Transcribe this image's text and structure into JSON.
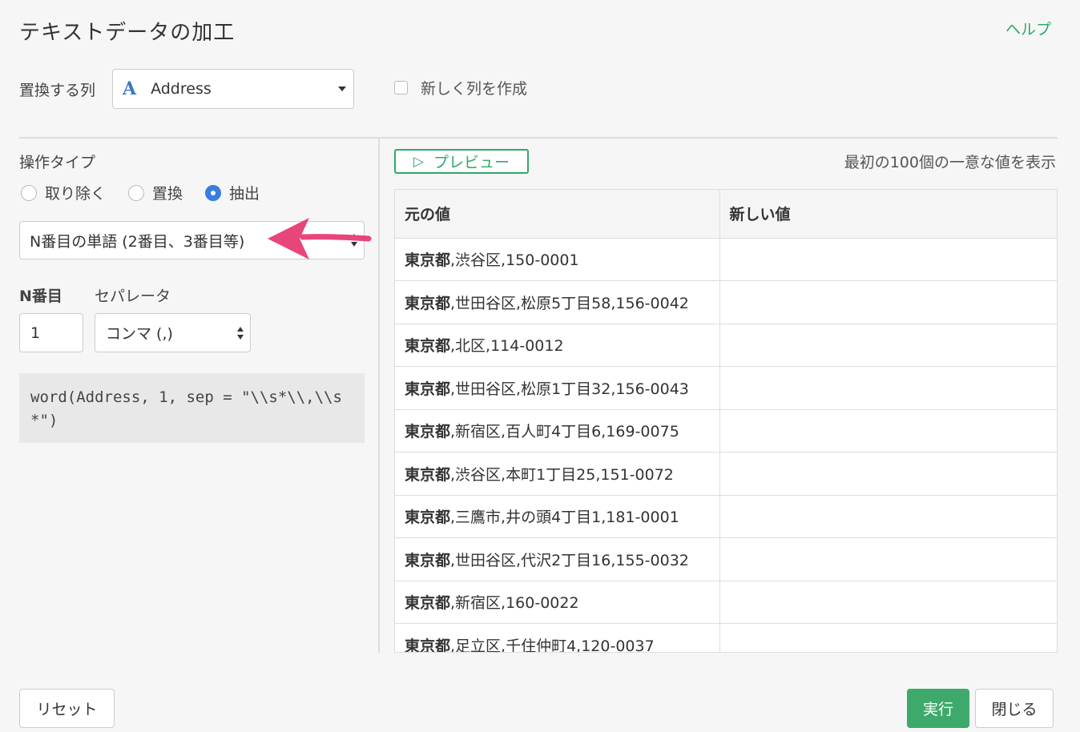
{
  "dialog": {
    "title": "テキストデータの加工",
    "help": "ヘルプ"
  },
  "column": {
    "label": "置換する列",
    "type_icon": "A",
    "selected": "Address",
    "new_column_label": "新しく列を作成",
    "new_column_checked": false
  },
  "operation": {
    "label": "操作タイプ",
    "options": [
      "取り除く",
      "置換",
      "抽出"
    ],
    "selected": "抽出",
    "method": "N番目の単語 (2番目、3番目等)"
  },
  "params": {
    "n_label": "N番目",
    "n_value": "1",
    "separator_label": "セパレータ",
    "separator_value": "コンマ (,)"
  },
  "code": "word(Address, 1, sep = \"\\\\s*\\\\,\\\\s*\")",
  "preview": {
    "button": "プレビュー",
    "note": "最初の100個の一意な値を表示",
    "headers": [
      "元の値",
      "新しい値"
    ],
    "rows": [
      {
        "pref": "東京都",
        "rest": ",渋谷区,150-0001",
        "new": ""
      },
      {
        "pref": "東京都",
        "rest": ",世田谷区,松原5丁目58,156-0042",
        "new": ""
      },
      {
        "pref": "東京都",
        "rest": ",北区,114-0012",
        "new": ""
      },
      {
        "pref": "東京都",
        "rest": ",世田谷区,松原1丁目32,156-0043",
        "new": ""
      },
      {
        "pref": "東京都",
        "rest": ",新宿区,百人町4丁目6,169-0075",
        "new": ""
      },
      {
        "pref": "東京都",
        "rest": ",渋谷区,本町1丁目25,151-0072",
        "new": ""
      },
      {
        "pref": "東京都",
        "rest": ",三鷹市,井の頭4丁目1,181-0001",
        "new": ""
      },
      {
        "pref": "東京都",
        "rest": ",世田谷区,代沢2丁目16,155-0032",
        "new": ""
      },
      {
        "pref": "東京都",
        "rest": ",新宿区,160-0022",
        "new": ""
      },
      {
        "pref": "東京都",
        "rest": ",足立区,千住仲町4,120-0037",
        "new": ""
      }
    ]
  },
  "footer": {
    "reset": "リセット",
    "run": "実行",
    "close": "閉じる"
  },
  "colors": {
    "accent_green": "#2fa86a",
    "radio_blue": "#3a7de0",
    "annotation_arrow": "#e8457a"
  }
}
